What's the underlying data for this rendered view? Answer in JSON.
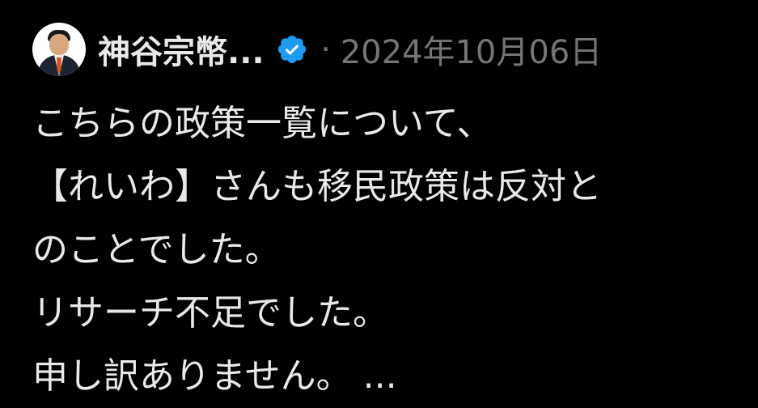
{
  "post": {
    "author_name": "神谷宗幣...",
    "verified_icon": "verified-badge-icon",
    "separator": "·",
    "date": "2024年10月06日",
    "text_lines": [
      "こちらの政策一覧について、",
      "【れいわ】さんも移民政策は反対と",
      "のことでした。",
      "リサーチ不足でした。",
      "申し訳ありません。 ..."
    ]
  },
  "colors": {
    "background": "#000000",
    "text": "#e7e9ea",
    "muted": "#71767b",
    "verified": "#1d9bf0"
  }
}
